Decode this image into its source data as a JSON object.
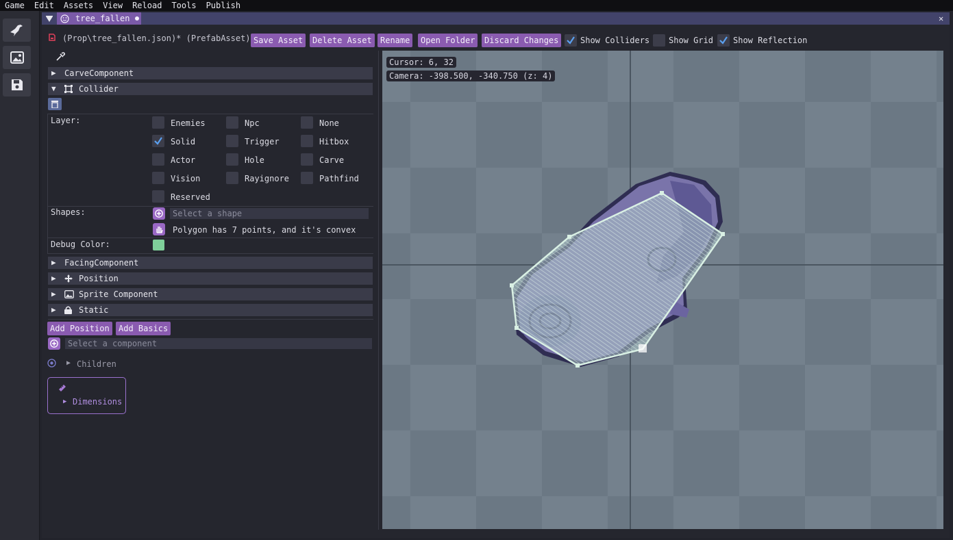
{
  "menubar": {
    "items": [
      "Game",
      "Edit",
      "Assets",
      "View",
      "Reload",
      "Tools",
      "Publish"
    ]
  },
  "left_toolbar": {
    "buttons": [
      "raven-icon",
      "image-icon",
      "save-disk-icon"
    ]
  },
  "window": {
    "tab_title": "tree_fallen",
    "close_glyph": "✕"
  },
  "asset_bar": {
    "path": "(Prop\\tree_fallen.json)* (PrefabAsset)",
    "buttons": {
      "save": "Save Asset",
      "delete": "Delete Asset",
      "rename": "Rename",
      "open_folder": "Open Folder",
      "discard": "Discard Changes"
    },
    "toggles": [
      {
        "label": "Show Colliders",
        "checked": true
      },
      {
        "label": "Show Grid",
        "checked": false
      },
      {
        "label": "Show Reflection",
        "checked": true
      }
    ]
  },
  "components": {
    "carve": "CarveComponent",
    "collider": "Collider",
    "facing": "FacingComponent",
    "position": "Position",
    "sprite": "Sprite Component",
    "static": "Static"
  },
  "collider": {
    "layer_label": "Layer:",
    "layers": [
      {
        "name": "Enemies",
        "checked": false
      },
      {
        "name": "Npc",
        "checked": false
      },
      {
        "name": "None",
        "checked": false
      },
      {
        "name": "Solid",
        "checked": true
      },
      {
        "name": "Trigger",
        "checked": false
      },
      {
        "name": "Hitbox",
        "checked": false
      },
      {
        "name": "Actor",
        "checked": false
      },
      {
        "name": "Hole",
        "checked": false
      },
      {
        "name": "Carve",
        "checked": false
      },
      {
        "name": "Vision",
        "checked": false
      },
      {
        "name": "Rayignore",
        "checked": false
      },
      {
        "name": "Pathfind",
        "checked": false
      },
      {
        "name": "Reserved",
        "checked": false
      }
    ],
    "shapes_label": "Shapes:",
    "shape_placeholder": "Select a shape",
    "polygon_info": "Polygon has 7 points, and it's convex",
    "debug_color_label": "Debug Color:",
    "debug_color": "#7fcf9a"
  },
  "bottom": {
    "add_position": "Add Position",
    "add_basics": "Add Basics",
    "component_placeholder": "Select a component",
    "children": "Children",
    "dimensions": "Dimensions"
  },
  "viewport": {
    "cursor": "Cursor: 6, 32",
    "camera": "Camera: -398.500, -340.750 (z: 4)"
  },
  "colors": {
    "accent": "#8a5bb0",
    "tab": "#7a5aa8",
    "collider_fill": "#b8d4cc",
    "log_purple": "#7b72a8"
  }
}
